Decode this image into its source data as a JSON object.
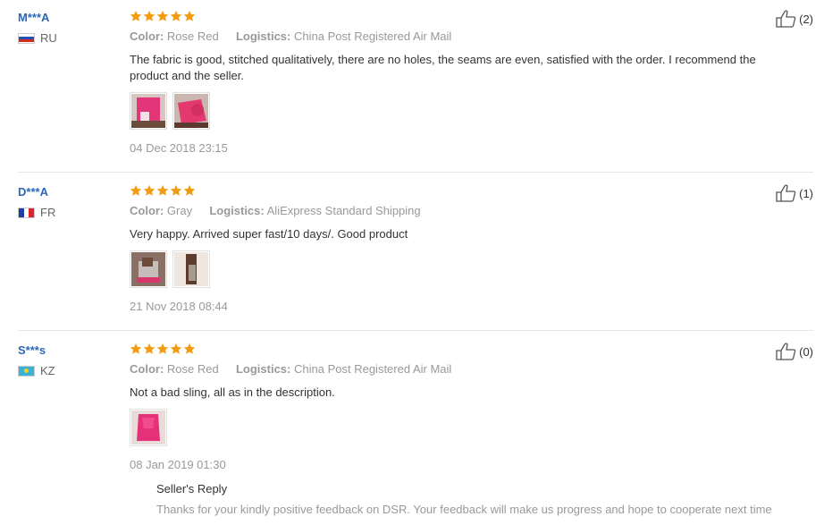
{
  "reviews": [
    {
      "user": "M***A",
      "country": "RU",
      "stars": 5,
      "color_label": "Color:",
      "color_value": "Rose Red",
      "logistics_label": "Logistics:",
      "logistics_value": "China Post Registered Air Mail",
      "text": "The fabric is good, stitched qualitatively, there are no holes, the seams are even, satisfied with the order. I recommend the product and the seller.",
      "photos": 2,
      "date": "04 Dec 2018 23:15",
      "helpful": "(2)"
    },
    {
      "user": "D***A",
      "country": "FR",
      "stars": 5,
      "color_label": "Color:",
      "color_value": "Gray",
      "logistics_label": "Logistics:",
      "logistics_value": "AliExpress Standard Shipping",
      "text": "Very happy. Arrived super fast/10 days/. Good product",
      "photos": 2,
      "date": "21 Nov 2018 08:44",
      "helpful": "(1)"
    },
    {
      "user": "S***s",
      "country": "KZ",
      "stars": 5,
      "color_label": "Color:",
      "color_value": "Rose Red",
      "logistics_label": "Logistics:",
      "logistics_value": "China Post Registered Air Mail",
      "text": "Not a bad sling, all as in the description.",
      "photos": 1,
      "date": "08 Jan 2019 01:30",
      "helpful": "(0)",
      "reply_title": "Seller's Reply",
      "reply_text": "Thanks for your kindly positive feedback on DSR. Your feedback will make us progress and hope to cooperate next time"
    }
  ],
  "colors": {
    "username": "#2c67b8",
    "star": "#f39c12",
    "muted": "#999999"
  }
}
